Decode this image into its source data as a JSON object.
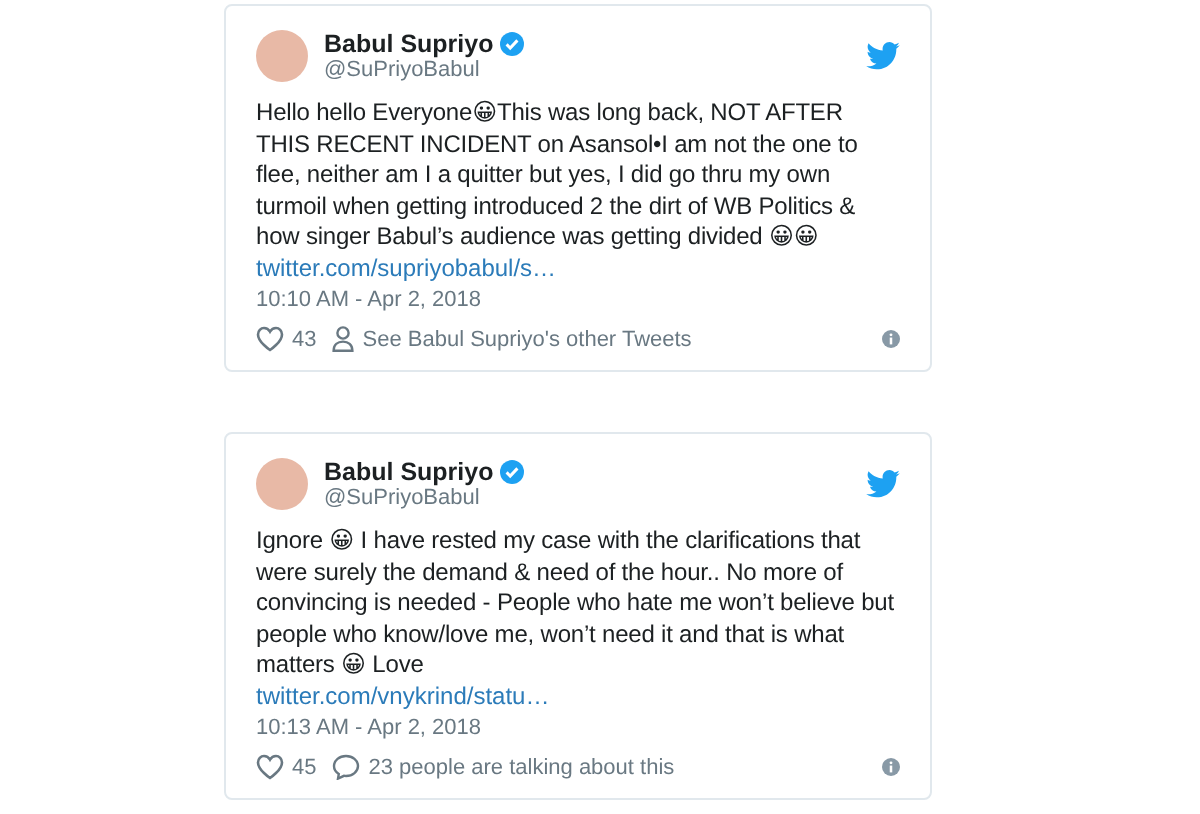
{
  "tweets": [
    {
      "name": "Babul Supriyo",
      "verified": true,
      "handle": "@SuPriyoBabul",
      "text": "Hello hello Everyone😀This was long back, NOT AFTER THIS RECENT INCIDENT on Asansol•I am not the one to flee, neither am I a quitter but yes, I did go thru my own turmoil when getting introduced 2 the dirt of WB Politics & how singer Babul’s audience was getting divided 😀😀",
      "link": "twitter.com/supriyobabul/s…",
      "time": "10:10 AM - Apr 2, 2018",
      "likes": "43",
      "action": {
        "kind": "profile",
        "text": "See Babul Supriyo's other Tweets"
      }
    },
    {
      "name": "Babul Supriyo",
      "verified": true,
      "handle": "@SuPriyoBabul",
      "text": "Ignore 😀 I have rested my case with the clarifications that were surely the demand & need of the hour.. No more of convincing is needed - People who hate me won’t believe but people who know/love me, won’t need it and that is what matters 😀 Love",
      "link": "twitter.com/vnykrind/statu…",
      "time": "10:13 AM - Apr 2, 2018",
      "likes": "45",
      "action": {
        "kind": "comment",
        "text": "23 people are talking about this"
      }
    }
  ]
}
